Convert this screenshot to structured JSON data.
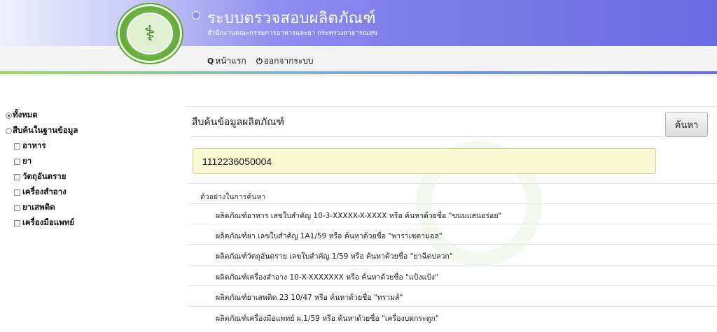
{
  "header": {
    "title": "ระบบตรวจสอบผลิตภัณฑ์",
    "subtitle": "สำนักงานคณะกรรมการอาหารและยา กระทรวงสาธารณสุข",
    "logo_icon": "caduceus-icon"
  },
  "nav": {
    "home_label": "หน้าแรก",
    "home_icon": "search-icon",
    "logout_label": "ออกจากระบบ",
    "logout_icon": "power-icon"
  },
  "sidebar": {
    "options": [
      {
        "label": "ทั้งหมด",
        "type": "radio",
        "checked": true
      },
      {
        "label": "สืบค้นในฐานข้อมูล",
        "type": "radio",
        "checked": false
      }
    ],
    "categories": [
      {
        "label": "อาหาร",
        "checked": false
      },
      {
        "label": "ยา",
        "checked": false
      },
      {
        "label": "วัตถุอันตราย",
        "checked": false
      },
      {
        "label": "เครื่องสำอาง",
        "checked": false
      },
      {
        "label": "ยาเสพติด",
        "checked": false
      },
      {
        "label": "เครื่องมือแพทย์",
        "checked": false
      }
    ]
  },
  "main": {
    "title": "สืบค้นข้อมูลผลิตภัณฑ์",
    "search_button": "ค้นหา",
    "search_value": "1112236050004",
    "examples_heading": "ตัวอย่างในการค้นหา",
    "examples": [
      "ผลิตภัณฑ์อาหาร เลขใบสำคัญ 10-3-XXXXX-X-XXXX หรือ ค้นหาด้วยชื่อ  \"ขนมแสนอร่อย\"",
      "ผลิตภัณฑ์ยา เลขใบสำคัญ 1A1/59 หรือ ค้นหาด้วยชื่อ \"พาราเซตามอล\"",
      "ผลิตภัณฑ์วัตถุอันตราย เลขใบสำคัญ 1/59 หรือ ค้นหาด้วยชื่อ \"ยาฉีดปลวก\"",
      "ผลิตภัณฑ์เครื่องสำอาง 10-X-XXXXXXX หรือ ค้นหาด้วยชื่อ \"แป้งแป้ง\"",
      "ผลิตภัณฑ์ยาเสพติด 23 10/47 หรือ ค้นหาด้วยชื่อ \"ทรามส์\"",
      "ผลิตภัณฑ์เครื่องมือแพทย์ ผ.1/59 หรือ ค้นหาด้วยชื่อ \"เครื่องบดกระดูก\""
    ]
  },
  "colors": {
    "banner_start": "#eef0fb",
    "banner_end": "#6d6be3",
    "logo_green": "#6fb343",
    "input_bg": "#fafad2"
  }
}
